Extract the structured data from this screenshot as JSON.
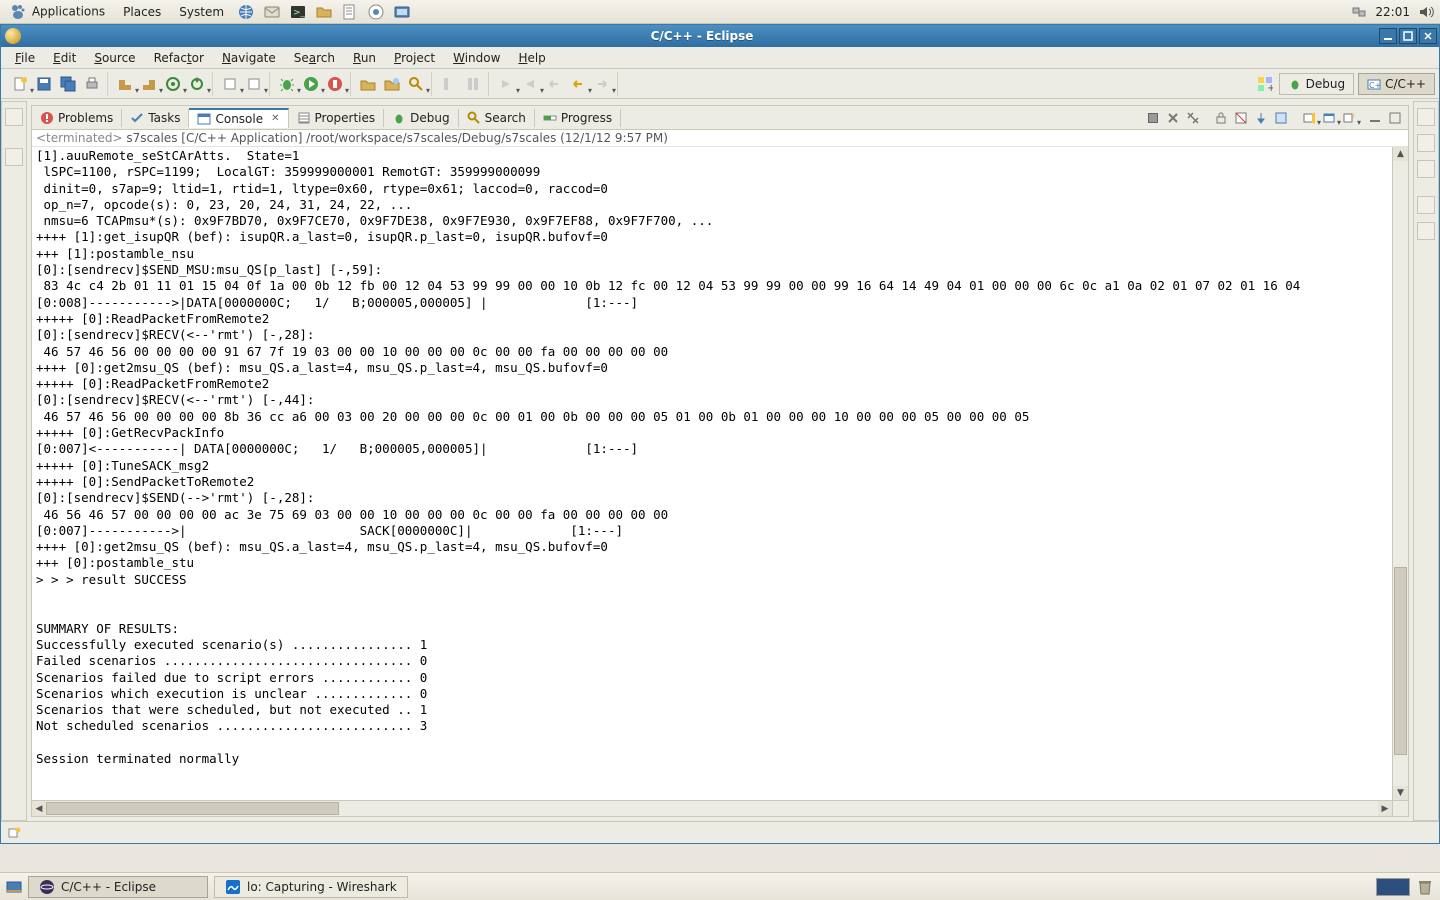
{
  "gnome": {
    "menus": [
      "Applications",
      "Places",
      "System"
    ],
    "clock": "22:01"
  },
  "eclipse": {
    "title": "C/C++ - Eclipse",
    "menubar": [
      "File",
      "Edit",
      "Source",
      "Refactor",
      "Navigate",
      "Search",
      "Run",
      "Project",
      "Window",
      "Help"
    ],
    "perspectives": {
      "debug": "Debug",
      "cpp": "C/C++"
    },
    "tabs": {
      "problems": "Problems",
      "tasks": "Tasks",
      "console": "Console",
      "properties": "Properties",
      "debug": "Debug",
      "search": "Search",
      "progress": "Progress"
    },
    "console": {
      "header_prefix": "<terminated>",
      "header_rest": " s7scales [C/C++ Application] /root/workspace/s7scales/Debug/s7scales (12/1/12 9:57 PM)",
      "lines": [
        "[1].auuRemote_seStCArAtts.  State=1",
        " lSPC=1100, rSPC=1199;  LocalGT: 359999000001 RemotGT: 359999000099",
        " dinit=0, s7ap=9; ltid=1, rtid=1, ltype=0x60, rtype=0x61; laccod=0, raccod=0",
        " op_n=7, opcode(s): 0, 23, 20, 24, 31, 24, 22, ...",
        " nmsu=6 TCAPmsu*(s): 0x9F7BD70, 0x9F7CE70, 0x9F7DE38, 0x9F7E930, 0x9F7EF88, 0x9F7F700, ...",
        "++++ [1]:get_isupQR (bef): isupQR.a_last=0, isupQR.p_last=0, isupQR.bufovf=0",
        "+++ [1]:postamble_nsu",
        "[0]:[sendrecv]$SEND_MSU:msu_QS[p_last] [-,59]:",
        " 83 4c c4 2b 01 11 01 15 04 0f 1a 00 0b 12 fb 00 12 04 53 99 99 00 00 10 0b 12 fc 00 12 04 53 99 99 00 00 99 16 64 14 49 04 01 00 00 00 6c 0c a1 0a 02 01 07 02 01 16 04",
        "[0:008]----------->|DATA[0000000C;   1/   B;000005,000005] |             [1:---]",
        "+++++ [0]:ReadPacketFromRemote2",
        "[0]:[sendrecv]$RECV(<--'rmt') [-,28]:",
        " 46 57 46 56 00 00 00 00 91 67 7f 19 03 00 00 10 00 00 00 0c 00 00 fa 00 00 00 00 00",
        "++++ [0]:get2msu_QS (bef): msu_QS.a_last=4, msu_QS.p_last=4, msu_QS.bufovf=0",
        "+++++ [0]:ReadPacketFromRemote2",
        "[0]:[sendrecv]$RECV(<--'rmt') [-,44]:",
        " 46 57 46 56 00 00 00 00 8b 36 cc a6 00 03 00 20 00 00 00 0c 00 01 00 0b 00 00 00 05 01 00 0b 01 00 00 00 10 00 00 00 05 00 00 00 05",
        "+++++ [0]:GetRecvPackInfo",
        "[0:007]<-----------| DATA[0000000C;   1/   B;000005,000005]|             [1:---]",
        "+++++ [0]:TuneSACK_msg2",
        "+++++ [0]:SendPacketToRemote2",
        "[0]:[sendrecv]$SEND(-->'rmt') [-,28]:",
        " 46 56 46 57 00 00 00 00 ac 3e 75 69 03 00 00 10 00 00 00 0c 00 00 fa 00 00 00 00 00",
        "[0:007]----------->|                       SACK[0000000C]|             [1:---]",
        "++++ [0]:get2msu_QS (bef): msu_QS.a_last=4, msu_QS.p_last=4, msu_QS.bufovf=0",
        "+++ [0]:postamble_stu",
        "> > > result SUCCESS",
        "",
        "",
        "SUMMARY OF RESULTS:",
        "Successfully executed scenario(s) ................ 1",
        "Failed scenarios ................................. 0",
        "Scenarios failed due to script errors ............ 0",
        "Scenarios which execution is unclear ............. 0",
        "Scenarios that were scheduled, but not executed .. 1",
        "Not scheduled scenarios .......................... 3",
        "",
        "Session terminated normally"
      ]
    }
  },
  "taskbar": {
    "eclipse": "C/C++ - Eclipse",
    "wireshark": "lo: Capturing - Wireshark"
  }
}
